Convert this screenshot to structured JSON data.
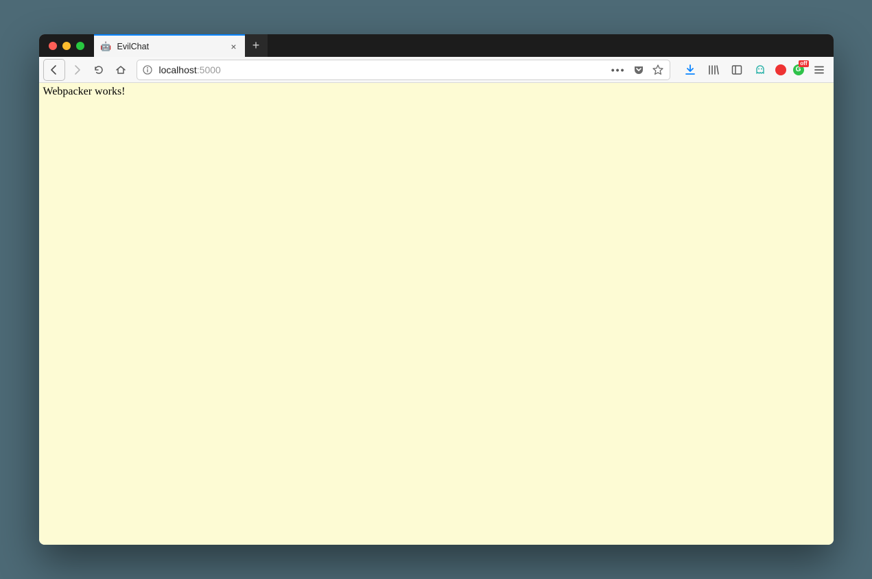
{
  "tab": {
    "title": "EvilChat",
    "favicon_emoji": "🤖"
  },
  "addressbar": {
    "host": "localhost",
    "port": ":5000"
  },
  "content": {
    "text": "Webpacker works!"
  },
  "toolbar_icons": {
    "downloads_color": "#0a84ff",
    "pocket_fill": "#6a6a6a",
    "ghost_color": "#35b5ac",
    "grammarly_letter": "G",
    "grammarly_off": "off"
  }
}
